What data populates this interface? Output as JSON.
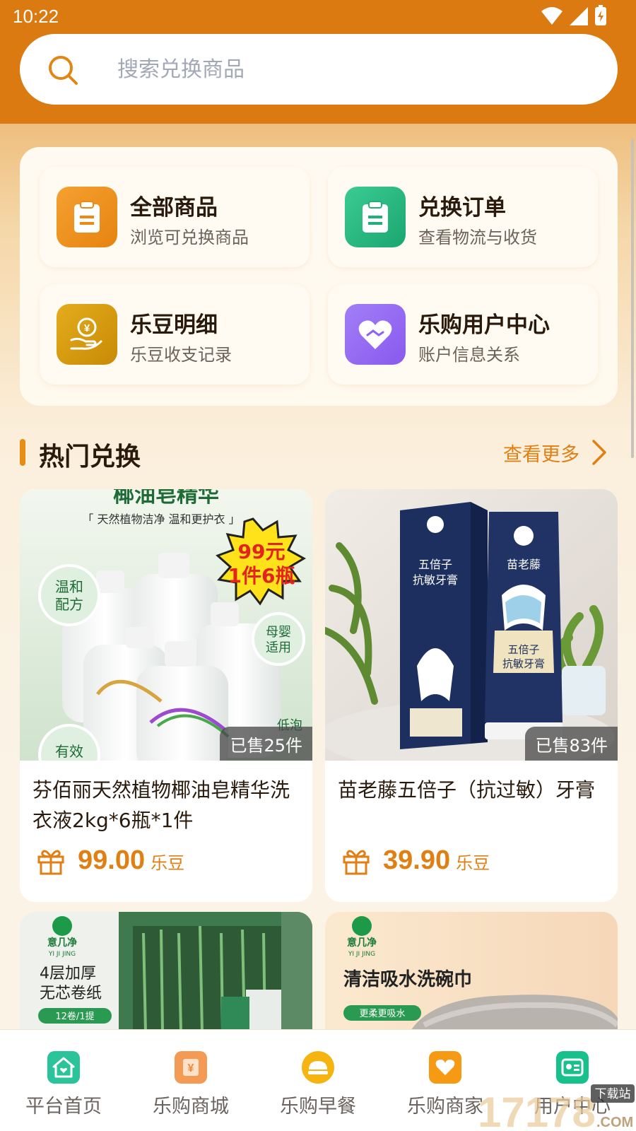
{
  "status_bar": {
    "time": "10:22"
  },
  "search": {
    "placeholder": "搜索兑换商品"
  },
  "quick_menu": [
    {
      "title": "全部商品",
      "subtitle": "浏览可兑换商品",
      "icon": "clipboard-icon",
      "color": "#ec8a12"
    },
    {
      "title": "兑换订单",
      "subtitle": "查看物流与收货",
      "icon": "clipboard-icon",
      "color": "#22b07a"
    },
    {
      "title": "乐豆明细",
      "subtitle": "乐豆收支记录",
      "icon": "coin-hand-icon",
      "color": "#d69a0b"
    },
    {
      "title": "乐购用户中心",
      "subtitle": "账户信息关系",
      "icon": "heart-handshake-icon",
      "color": "#9a6cf3"
    }
  ],
  "section": {
    "title": "热门兑换",
    "more_label": "查看更多"
  },
  "products": [
    {
      "name": "芬佰丽天然植物椰油皂精华洗衣液2kg*6瓶*1件",
      "sold": "已售25件",
      "price": "99.00",
      "unit": "乐豆",
      "image": {
        "headline": "椰油皂精华",
        "tagline": "「 天然植物洁净 温和更护衣 」",
        "burst_line1": "99元",
        "burst_line2": "1件6瓶",
        "badge_left_1": "温和",
        "badge_left_2": "配方",
        "badge_right_1": "母婴",
        "badge_right_2": "适用",
        "badge_bottom_left": "有效",
        "badge_bottom_right": "低泡"
      }
    },
    {
      "name": "苗老藤五倍子（抗过敏）牙膏",
      "sold": "已售83件",
      "price": "39.90",
      "unit": "乐豆",
      "image": {
        "brand": "苗老藤",
        "box_line1": "五倍子",
        "box_line2": "抗敏牙膏",
        "tube_line1": "五倍子",
        "tube_line2": "抗敏牙膏"
      }
    },
    {
      "image": {
        "brand": "意几净",
        "brand_pinyin": "YI JI JING",
        "line1": "4层加厚",
        "line2": "无芯卷纸",
        "tag": "12卷/1提"
      }
    },
    {
      "image": {
        "brand": "意几净",
        "brand_pinyin": "YI JI JING",
        "headline": "清洁吸水洗碗巾",
        "tag": "更柔更吸水"
      }
    }
  ],
  "bottom_nav": [
    {
      "label": "平台首页",
      "icon": "home-icon",
      "color": "#2bc39a"
    },
    {
      "label": "乐购商城",
      "icon": "store-icon",
      "color": "#f39a55"
    },
    {
      "label": "乐购早餐",
      "icon": "breakfast-icon",
      "color": "#f5b40f"
    },
    {
      "label": "乐购商家",
      "icon": "merchant-icon",
      "color": "#f59a12"
    },
    {
      "label": "用户中心",
      "icon": "user-card-icon",
      "color": "#18c08a"
    }
  ],
  "watermark": {
    "text": "17178",
    "sub": "下载站",
    "domain": ".COM"
  },
  "colors": {
    "header": "#da7a10",
    "accent": "#e07f14",
    "text": "#2a1a0c"
  }
}
